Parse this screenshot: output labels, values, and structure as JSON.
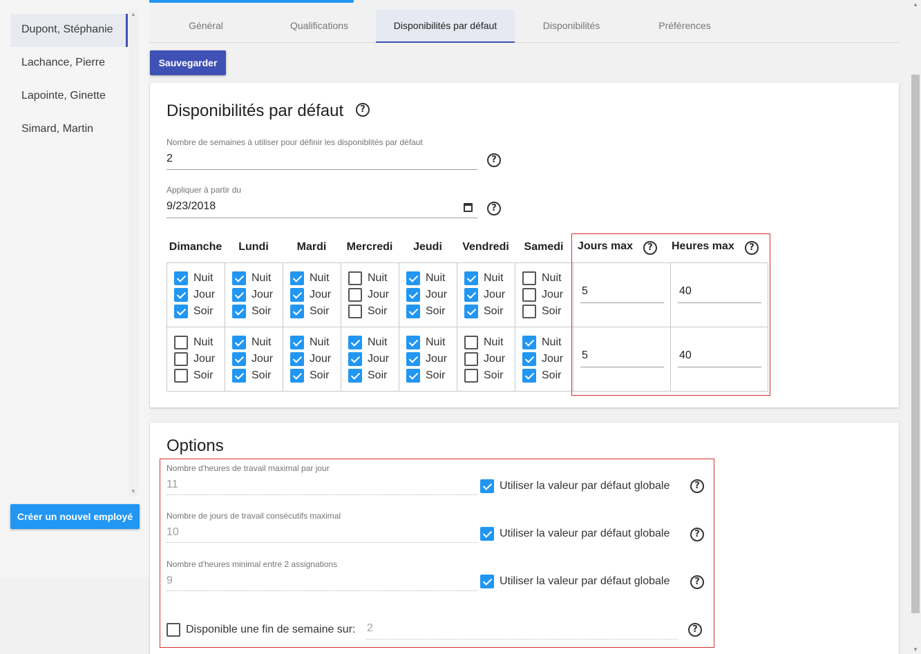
{
  "sidebar": {
    "employees": [
      "Dupont, Stéphanie",
      "Lachance, Pierre",
      "Lapointe, Ginette",
      "Simard, Martin"
    ],
    "new_employee_button": "Créer un nouvel employé"
  },
  "tabs": [
    "Général",
    "Qualifications",
    "Disponibilités par défaut",
    "Disponibilités",
    "Préférences"
  ],
  "active_tab": "Disponibilités par défaut",
  "save_button": "Sauvegarder",
  "availability": {
    "title": "Disponibilités par défaut",
    "weeks_label": "Nombre de semaines à utiliser pour définir les disponiblités par défaut",
    "weeks_value": "2",
    "apply_label": "Appliquer à partir du",
    "apply_value": "9/23/2018",
    "days": [
      "Dimanche",
      "Lundi",
      "Mardi",
      "Mercredi",
      "Jeudi",
      "Vendredi",
      "Samedi"
    ],
    "shifts": [
      "Nuit",
      "Jour",
      "Soir"
    ],
    "max_days_header": "Jours max",
    "max_hours_header": "Heures max",
    "weeks": [
      {
        "max_days": "5",
        "max_hours": "40",
        "checks": [
          [
            true,
            true,
            true
          ],
          [
            true,
            true,
            true
          ],
          [
            true,
            true,
            true
          ],
          [
            false,
            false,
            false
          ],
          [
            true,
            true,
            true
          ],
          [
            true,
            true,
            true
          ],
          [
            false,
            false,
            false
          ]
        ]
      },
      {
        "max_days": "5",
        "max_hours": "40",
        "checks": [
          [
            false,
            false,
            false
          ],
          [
            true,
            true,
            true
          ],
          [
            true,
            true,
            true
          ],
          [
            true,
            true,
            true
          ],
          [
            true,
            true,
            true
          ],
          [
            false,
            false,
            false
          ],
          [
            true,
            true,
            true
          ]
        ]
      }
    ]
  },
  "options": {
    "title": "Options",
    "use_default_label": "Utiliser la valeur par défaut globale",
    "fields": [
      {
        "label": "Nombre d'heures de travail maximal par jour",
        "value": "11",
        "use_default": true
      },
      {
        "label": "Nombre de jours de travail consécutifs maximal",
        "value": "10",
        "use_default": true
      },
      {
        "label": "Nombre d'heures minimal entre 2 assignations",
        "value": "9",
        "use_default": true
      }
    ],
    "weekend_label": "Disponible une fin de semaine sur:",
    "weekend_value": "2",
    "weekend_checked": false
  },
  "colors": {
    "primary": "#3f51b5",
    "accent": "#2196f3",
    "highlight_border": "#d32f2f"
  }
}
